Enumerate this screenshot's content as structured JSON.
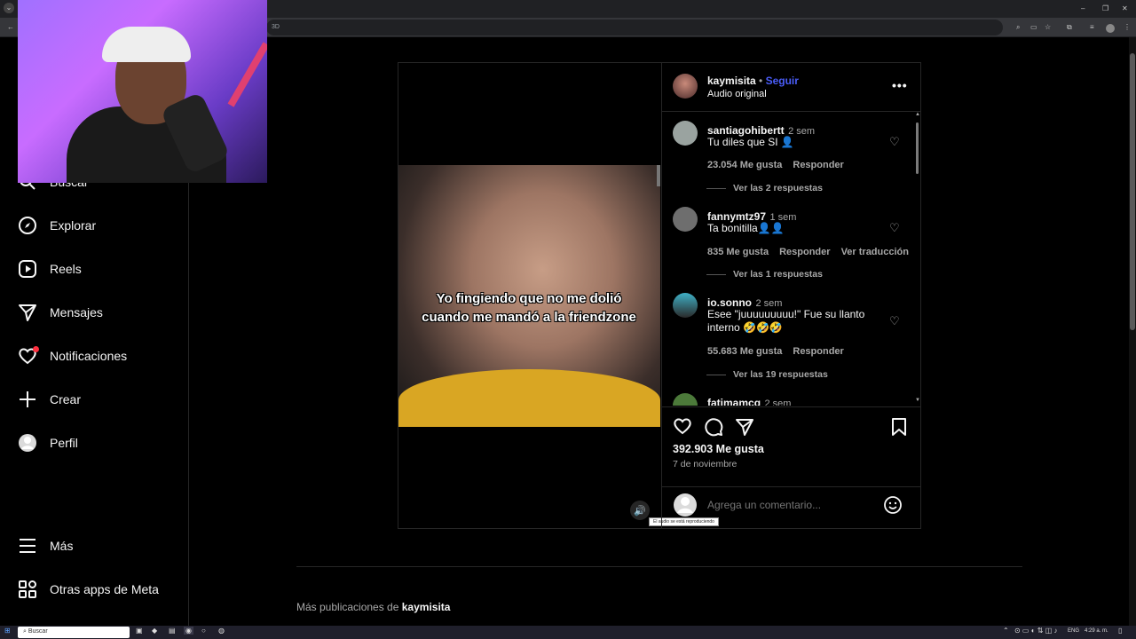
{
  "browser": {
    "url_fragment": "3D"
  },
  "sidebar": {
    "items": [
      {
        "label": "Buscar",
        "icon": "search-icon"
      },
      {
        "label": "Explorar",
        "icon": "compass-icon"
      },
      {
        "label": "Reels",
        "icon": "reels-icon"
      },
      {
        "label": "Mensajes",
        "icon": "send-icon"
      },
      {
        "label": "Notificaciones",
        "icon": "heart-icon"
      },
      {
        "label": "Crear",
        "icon": "plus-icon"
      },
      {
        "label": "Perfil",
        "icon": "avatar-icon"
      }
    ],
    "more": "Más",
    "meta_apps": "Otras apps de Meta"
  },
  "post": {
    "username": "kaymisita",
    "follow": "Seguir",
    "separator": "•",
    "audio": "Audio original",
    "overlay_text": "Yo fingiendo que no me dolió cuando me mandó a la friendzone",
    "tooltip": "El audio se está reproduciendo",
    "likes": "392.903 Me gusta",
    "date": "7 de noviembre",
    "comment_placeholder": "Agrega un comentario...",
    "comments": [
      {
        "user": "santiagohibertt",
        "time": "2 sem",
        "text": "Tu diles que SI 👤",
        "likes": "23.054 Me gusta",
        "reply": "Responder",
        "translate": "",
        "replies": "Ver las 2 respuestas"
      },
      {
        "user": "fannymtz97",
        "time": "1 sem",
        "text": "Ta bonitilla👤👤",
        "likes": "835 Me gusta",
        "reply": "Responder",
        "translate": "Ver traducción",
        "replies": "Ver las 1 respuestas"
      },
      {
        "user": "io.sonno",
        "time": "2 sem",
        "text": "Esee \"juuuuuuuuu!\" Fue su llanto interno 🤣🤣🤣",
        "likes": "55.683 Me gusta",
        "reply": "Responder",
        "translate": "",
        "replies": "Ver las 19 respuestas"
      },
      {
        "user": "fatimamcg",
        "time": "2 sem",
        "text": "",
        "likes": "",
        "reply": "",
        "translate": "",
        "replies": ""
      }
    ]
  },
  "more_publications": {
    "prefix": "Más publicaciones de",
    "user": "kaymisita"
  },
  "taskbar": {
    "search": "Buscar",
    "lang": "ENG",
    "time": "4:29 a. m."
  },
  "colors": {
    "link_blue": "#4a5df9",
    "background": "#000000",
    "muted": "#a8a8a8"
  }
}
